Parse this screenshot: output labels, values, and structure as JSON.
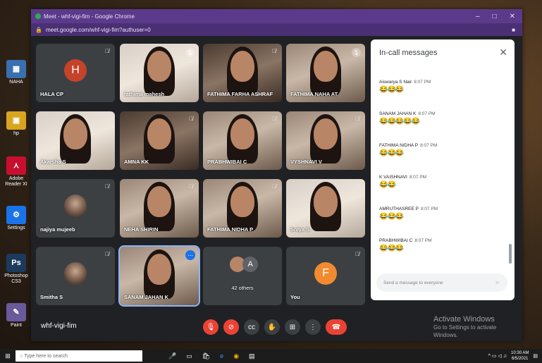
{
  "desktop": {
    "icons": [
      {
        "label": "NAHA",
        "glyph": "▦",
        "color": "#3a6fb0"
      },
      {
        "label": "hp",
        "glyph": "▣",
        "color": "#d9a520"
      },
      {
        "label": "Adobe Reader XI",
        "glyph": "⋏",
        "color": "#c8102e"
      },
      {
        "label": "Settings",
        "glyph": "⚙",
        "color": "#1a73e8"
      },
      {
        "label": "Photoshop CS3",
        "glyph": "Ps",
        "color": "#1b3a5c"
      },
      {
        "label": "Paint",
        "glyph": "✎",
        "color": "#6a5a9c"
      }
    ]
  },
  "window": {
    "title": "Meet - whf-vigi-fim - Google Chrome",
    "url": "meet.google.com/whf-vigi-fim?authuser=0"
  },
  "tiles": [
    {
      "name": "HALA CP",
      "type": "avatar",
      "letter": "H",
      "color": "#c5432a",
      "mic": "muted"
    },
    {
      "name": "fathima mahesh",
      "type": "video",
      "mic": "circle"
    },
    {
      "name": "FATHIMA FARHA ASHRAF",
      "type": "video",
      "mic": "muted"
    },
    {
      "name": "FATHIMA NAHA AT",
      "type": "video",
      "mic": "circle"
    },
    {
      "name": "Akarsha S",
      "type": "video",
      "mic": "muted"
    },
    {
      "name": "AMNA KK",
      "type": "video",
      "mic": "muted"
    },
    {
      "name": "PRABHWIBAI C",
      "type": "video",
      "mic": "muted"
    },
    {
      "name": "VYSHNAVI V",
      "type": "video",
      "mic": "muted"
    },
    {
      "name": "najiya mujeeb",
      "type": "avatarimg",
      "mic": "muted"
    },
    {
      "name": "NEHA SHIRIN",
      "type": "video",
      "mic": "muted"
    },
    {
      "name": "FATHIMA NIDHA P",
      "type": "video",
      "mic": "muted"
    },
    {
      "name": "Sniya S",
      "type": "video",
      "mic": "muted"
    },
    {
      "name": "Smitha S",
      "type": "avatarimg",
      "mic": "muted"
    },
    {
      "name": "SANAM JAHAN K",
      "type": "video",
      "mic": "more",
      "selected": true
    },
    {
      "name": "42 others",
      "type": "others",
      "letter": "A"
    },
    {
      "name": "You",
      "type": "avatar",
      "letter": "F",
      "color": "#f28b30",
      "mic": "muted"
    }
  ],
  "panel": {
    "title": "In-call messages",
    "messages": [
      {
        "sender": "Aiswarya S Nair",
        "time": "8:07 PM",
        "emoji": "😂😂😂"
      },
      {
        "sender": "SANAM JAHAN K",
        "time": "8:07 PM",
        "emoji": "😂😂😂😂😂"
      },
      {
        "sender": "FATHIMA NIDHA P",
        "time": "8:07 PM",
        "emoji": "😂😂😂"
      },
      {
        "sender": "K VAISHNAVI",
        "time": "8:07 PM",
        "emoji": "😂😂"
      },
      {
        "sender": "AMRUTHASREE P",
        "time": "8:07 PM",
        "emoji": "😂😂😂"
      },
      {
        "sender": "PRABHWIBAI C",
        "time": "8:07 PM",
        "emoji": "😂😂😂"
      }
    ],
    "placeholder": "Send a message to everyone"
  },
  "bottom": {
    "meeting_code": "whf-vigi-fim",
    "controls": [
      "mic-off",
      "cam-off",
      "captions",
      "raise-hand",
      "present",
      "more",
      "hang-up"
    ],
    "watermark1": "Activate Windows",
    "watermark2": "Go to Settings to activate Windows."
  },
  "taskbar": {
    "search_placeholder": "Type here to search",
    "time": "10:30 AM",
    "date": "6/5/2021"
  }
}
